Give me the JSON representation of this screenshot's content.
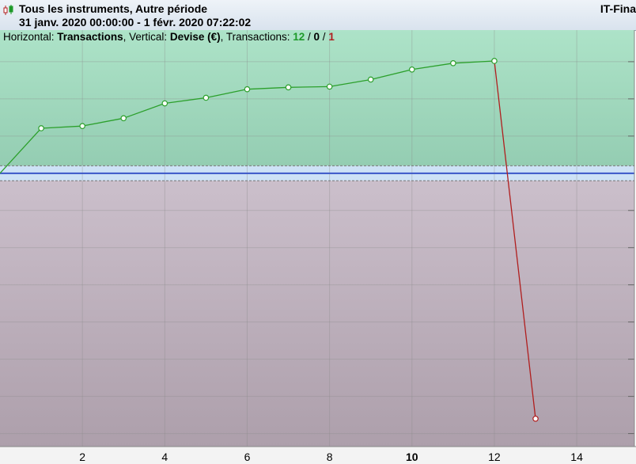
{
  "header": {
    "title": "Tous les instruments, Autre période",
    "subtitle": "31 janv. 2020 00:00:00 - 1 févr. 2020 07:22:02",
    "brand": "IT-Fina",
    "app_icon": "candlestick-icon"
  },
  "info_bar": {
    "horizontal_label": "Horizontal:",
    "horizontal_value": "Transactions",
    "vertical_label": ", Vertical:",
    "vertical_value": "Devise (€)",
    "transactions_label": ", Transactions:",
    "wins": "12",
    "sep1": " / ",
    "neutral": "0",
    "sep2": " / ",
    "losses": "1"
  },
  "colors": {
    "profit_zone": "#a8e0c4",
    "loss_zone": "#c2b5c1",
    "profit_line": "#2ca02c",
    "loss_line": "#b01e1e",
    "zero_line": "#3a56c8"
  },
  "chart_data": {
    "type": "line",
    "x": [
      0,
      1,
      2,
      3,
      4,
      5,
      6,
      7,
      8,
      9,
      10,
      11,
      12,
      13
    ],
    "series": [
      {
        "values": [
          0,
          1.21,
          1.27,
          1.48,
          1.88,
          2.03,
          2.26,
          2.31,
          2.33,
          2.52,
          2.79,
          2.96,
          3.02,
          -6.6
        ]
      }
    ],
    "xticks": [
      2,
      4,
      6,
      8,
      10,
      12,
      14
    ],
    "bold_xtick": 10,
    "xlim": [
      0,
      15.4
    ],
    "ylim": [
      -7.35,
      3.85
    ],
    "grid": true
  }
}
